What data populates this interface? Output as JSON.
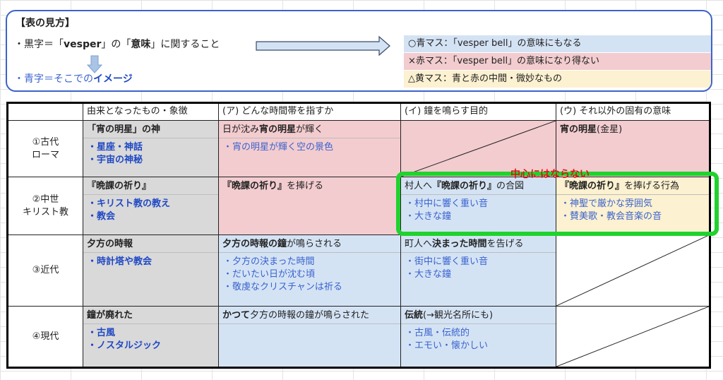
{
  "legend": {
    "title": "【表の見方】",
    "line1_prefix": "・黒字＝「",
    "line1_word": "vesper",
    "line1_mid": "」の「",
    "line1_meaning": "意味",
    "line1_suffix": "」に関すること",
    "line2_prefix": "・青字＝そこでの",
    "line2_bold": "イメージ",
    "blue_box": "○青マス：「vesper bell」の意味にもなる",
    "red_box": "×赤マス：「vesper bell」の意味になり得ない",
    "yellow_box": "△黄マス：青と赤の中間・微妙なもの"
  },
  "table": {
    "headers": [
      "",
      "由来となったもの・象徴",
      "(ア) どんな時間帯を指すか",
      "(イ) 鐘を鳴らす目的",
      "(ウ) それ以外の固有の意味"
    ],
    "rows": [
      {
        "era": "①古代\nローマ",
        "origin_title": "「宵の明星」の神",
        "origin_lines": "・星座・神話\n・宇宙の神秘",
        "a_title": "日が沈み宵の明星が輝く",
        "a_lines": "・宵の明星が輝く空の景色",
        "b_title": "",
        "b_lines": "",
        "c_title": "宵の明星(金星)",
        "c_lines": ""
      },
      {
        "era": "②中世\nキリスト教",
        "origin_title": "『晩課の祈り』",
        "origin_lines": "・キリスト教の教え\n・教会",
        "a_title": "『晩課の祈り』を捧げる",
        "a_lines": "",
        "b_title": "村人へ『晩課の祈り』の合図",
        "b_lines": "・村中に響く重い音\n・大きな鐘",
        "c_title": "『晩課の祈り』を捧げる行為",
        "c_lines": "・神聖で厳かな雰囲気\n・賛美歌・教会音楽の音"
      },
      {
        "era": "③近代",
        "origin_title": "夕方の時報",
        "origin_lines": "・時計塔や教会",
        "a_title": "夕方の時報の鐘が鳴らされる",
        "a_lines": "・夕方の決まった時間\n・だいたい日が沈む頃\n・敬虔なクリスチャンは祈る",
        "b_title": "町人へ決まった時間を告げる",
        "b_lines": "・街中に響く重い音\n・大きな鐘",
        "c_title": "",
        "c_lines": ""
      },
      {
        "era": "④現代",
        "origin_title": "鐘が廃れた",
        "origin_lines": "・古風\n・ノスタルジック",
        "a_title": "かつて夕方の時報の鐘が鳴らされた",
        "a_lines": "",
        "b_title": "伝統(→観光名所にも)",
        "b_lines": "・古風・伝統的\n・エモい・懐かしい",
        "c_title": "",
        "c_lines": ""
      }
    ]
  },
  "highlight_label": "中心にはならない",
  "colors": {
    "blue_cell": "#d4e3f4",
    "red_cell": "#f3cccf",
    "yellow_cell": "#fcf1d0",
    "gray_cell": "#d9d9d9",
    "highlight_border": "#20d22e",
    "highlight_text": "#e0141a"
  }
}
